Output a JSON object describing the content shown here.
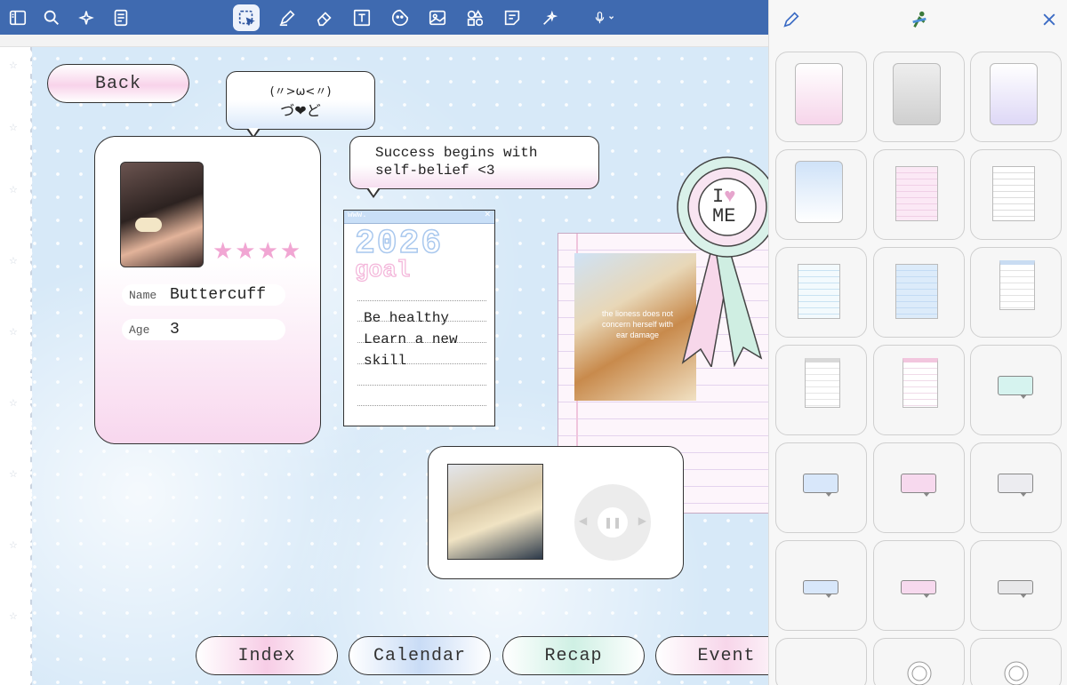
{
  "toolbar": {
    "tools": [
      "sidebar",
      "search",
      "ai-sparkle",
      "notebook",
      "lasso-select",
      "pen",
      "eraser",
      "text-box",
      "sticker",
      "image",
      "shapes",
      "sticky-note",
      "laser-pointer",
      "microphone"
    ]
  },
  "canvas": {
    "back_label": "Back",
    "kaomoji_line1": "(〃>ω<〃)",
    "kaomoji_line2": "づ❤ど",
    "quote_line1": "Success begins with",
    "quote_line2": "self-belief <3",
    "profile": {
      "stars": "★★★★",
      "name_label": "Name",
      "name_value": "Buttercuff",
      "age_label": "Age",
      "age_value": "3"
    },
    "goal": {
      "window_text": "www.",
      "year": "2026",
      "subtitle": "goal",
      "item1": "Be healthy",
      "item2": "Learn a new",
      "item3": "skill"
    },
    "rosette": {
      "line1": "I",
      "line2": "ME"
    },
    "dog_caption": "the lioness does not concern herself with ear damage",
    "nav": [
      "Index",
      "Calendar",
      "Recap",
      "Event"
    ]
  },
  "panel": {
    "title_icons": [
      "pencil-icon",
      "figure-icon",
      "close-icon"
    ]
  }
}
